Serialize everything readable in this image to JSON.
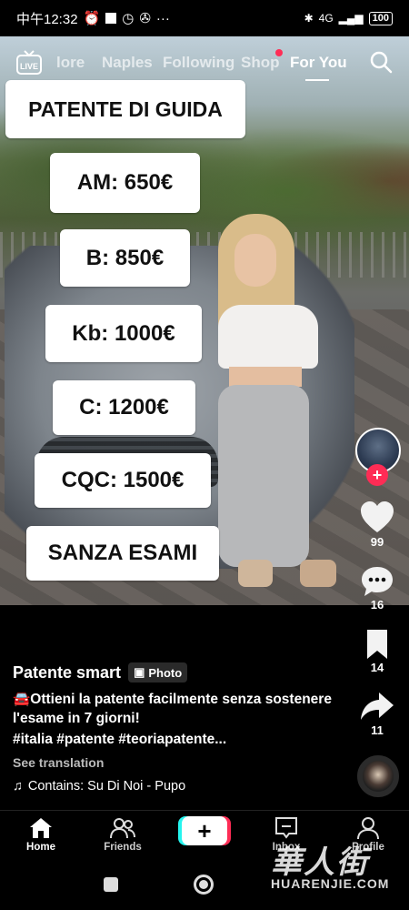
{
  "status_bar": {
    "time": "中午12:32",
    "network": "4G",
    "battery": "100"
  },
  "top_nav": {
    "tabs": [
      {
        "label": "lore"
      },
      {
        "label": "Naples"
      },
      {
        "label": "Following"
      },
      {
        "label": "Shop",
        "has_dot": true
      },
      {
        "label": "For You",
        "active": true
      }
    ]
  },
  "stickers": [
    {
      "text": "PATENTE DI GUIDA"
    },
    {
      "text": "AM: 650€"
    },
    {
      "text": "B: 850€"
    },
    {
      "text": "Kb: 1000€"
    },
    {
      "text": "C: 1200€"
    },
    {
      "text": "CQC: 1500€"
    },
    {
      "text": "SANZA ESAMI"
    }
  ],
  "rail": {
    "likes": "99",
    "comments": "16",
    "saves": "14",
    "shares": "11"
  },
  "caption": {
    "author": "Patente smart",
    "badge": "Photo",
    "description": "🚘Ottieni la patente facilmente senza sostenere l'esame in 7 giorni!",
    "hashtags": "#italia #patente #teoriapatente...",
    "see_translation": "See translation",
    "music": "Contains: Su Di Noi - Pupo"
  },
  "bottom_nav": {
    "home": "Home",
    "friends": "Friends",
    "inbox": "Inbox",
    "profile": "Profile"
  },
  "watermark": {
    "chinese": "華人街",
    "latin": "HUARENJIE.COM"
  },
  "colors": {
    "accent_red": "#fe2c55",
    "accent_cyan": "#25f4ee"
  }
}
